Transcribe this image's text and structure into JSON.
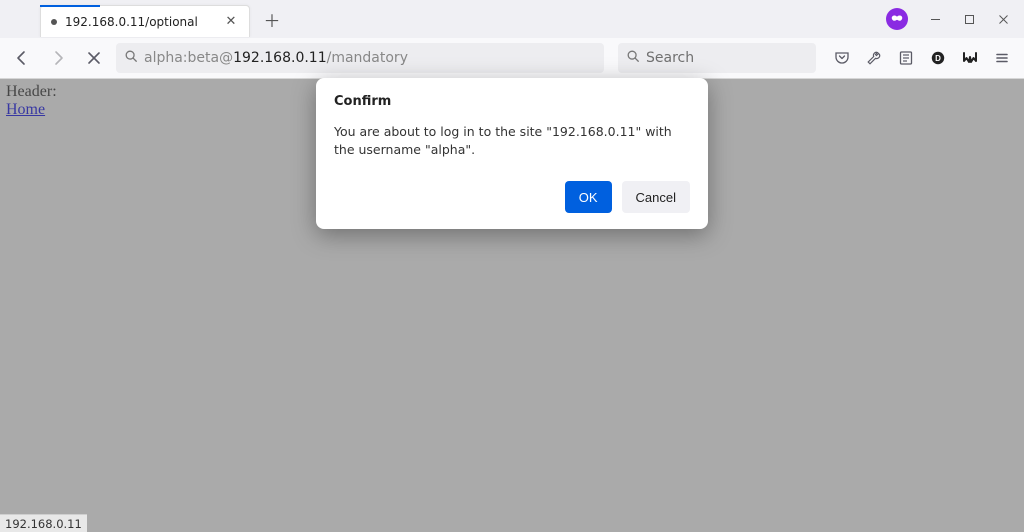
{
  "tab": {
    "title": "192.168.0.11/optional"
  },
  "url": {
    "prefix": "alpha:beta@",
    "host": "192.168.0.11",
    "suffix": "/mandatory"
  },
  "search": {
    "placeholder": "Search"
  },
  "page": {
    "header": "Header",
    "link": "Home"
  },
  "dialog": {
    "title": "Confirm",
    "body": "You are about to log in to the site \"192.168.0.11\" with the username \"alpha\".",
    "ok": "OK",
    "cancel": "Cancel"
  },
  "status": {
    "text": "192.168.0.11"
  }
}
